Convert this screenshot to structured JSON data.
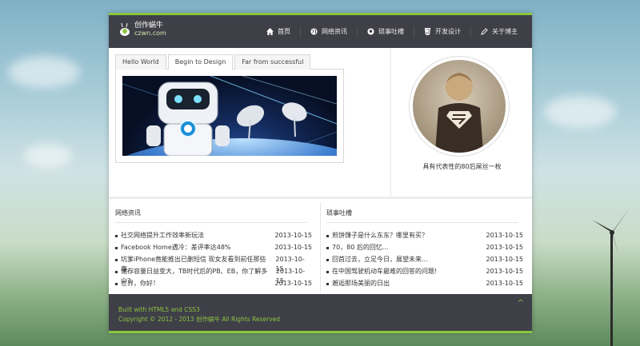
{
  "brand": {
    "name_cn": "创作蜗牛",
    "name_en": "czwn.com"
  },
  "nav": [
    {
      "label": "首页",
      "icon": "home-icon"
    },
    {
      "label": "网络资讯",
      "icon": "globe-icon"
    },
    {
      "label": "琐事吐槽",
      "icon": "github-icon"
    },
    {
      "label": "开发设计",
      "icon": "html5-icon"
    },
    {
      "label": "关于博主",
      "icon": "pencil-icon"
    }
  ],
  "tabs": [
    "Hello World",
    "Begin to Design",
    "Far from successful"
  ],
  "active_tab": 1,
  "profile": {
    "caption": "具有代表性的80后屌丝一枚"
  },
  "sections": {
    "news": {
      "title": "网络资讯",
      "items": [
        {
          "title": "社交网络提升工作效率新玩法",
          "date": "2013-10-15"
        },
        {
          "title": "Facebook Home遇冷：差评率达48%",
          "date": "2013-10-15"
        },
        {
          "title": "坑爹iPhone竟能推出已删短信 现女友看到前任那些事...",
          "date": "2013-10-15"
        },
        {
          "title": "储存容量日益变大，TB时代后的PB、EB，你了解多少？",
          "date": "2013-10-15"
        },
        {
          "title": "世界，你好！",
          "date": "2013-10-15"
        }
      ]
    },
    "gossip": {
      "title": "琐事吐槽",
      "items": [
        {
          "title": "煎饼馃子是什么东东？哪里有买？",
          "date": "2013-10-15"
        },
        {
          "title": "70，80 后的回忆...",
          "date": "2013-10-15"
        },
        {
          "title": "回首过去，立足今日，展望未来...",
          "date": "2013-10-15"
        },
        {
          "title": "在中国驾驶机动车最难的回答的问题!",
          "date": "2013-10-15"
        },
        {
          "title": "邂逅那场美丽的日出",
          "date": "2013-10-15"
        }
      ]
    }
  },
  "footer": {
    "line1": "Built with HTML5 and CSS3",
    "line2": "Copyright © 2012 - 2013 创作蜗牛 All Rights Reserved",
    "to_top": "^"
  },
  "colors": {
    "accent": "#8cc63f",
    "header_bg": "#3f3f48"
  }
}
